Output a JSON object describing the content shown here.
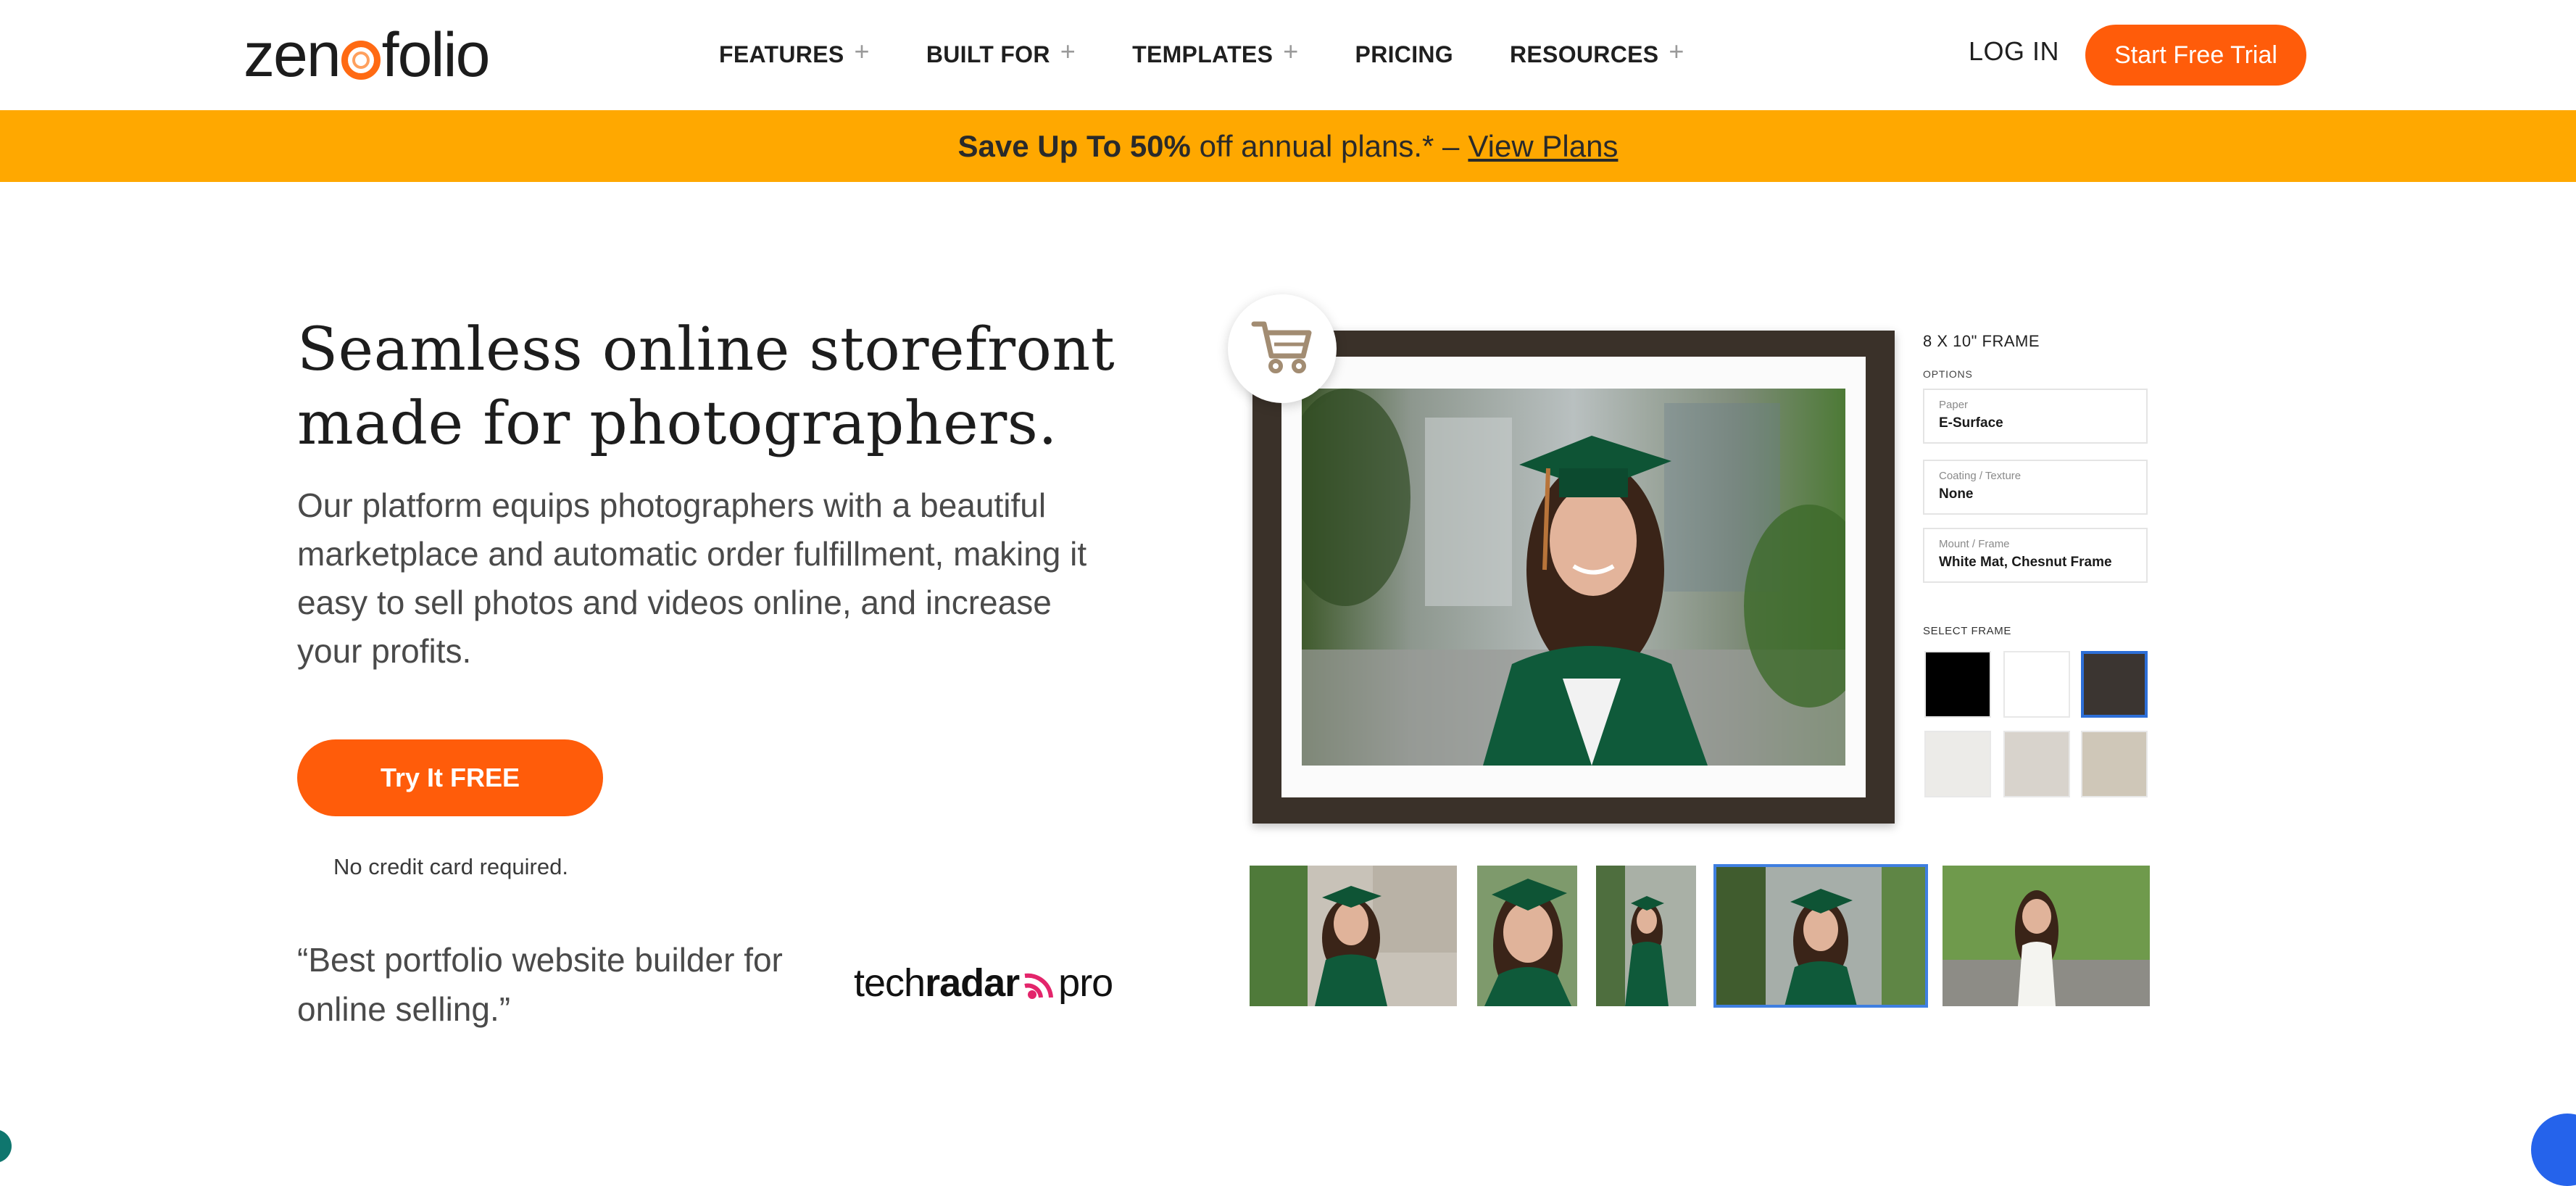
{
  "header": {
    "logo_text_pre": "zen",
    "logo_text_post": "folio",
    "nav": [
      {
        "label": "FEATURES",
        "has_plus": true
      },
      {
        "label": "BUILT FOR",
        "has_plus": true
      },
      {
        "label": "TEMPLATES",
        "has_plus": true
      },
      {
        "label": "PRICING",
        "has_plus": false
      },
      {
        "label": "RESOURCES",
        "has_plus": true
      }
    ],
    "login": "LOG IN",
    "trial_button": "Start Free Trial",
    "plus_icon": "plus-icon"
  },
  "promo": {
    "bold": "Save Up To 50%",
    "rest": "off annual plans.* –",
    "link": "View Plans"
  },
  "hero": {
    "headline_line1": "Seamless online storefront",
    "headline_line2": "made for photographers.",
    "subtext": "Our platform equips photographers with a beautiful marketplace and automatic order fulfillment, making it easy to sell photos and videos online, and increase your profits.",
    "cta": "Try It FREE",
    "no_credit_card": "No credit card required.",
    "quote": "“Best portfolio website builder for online selling.”",
    "techradar_pre": "tech",
    "techradar_bold": "radar",
    "techradar_post": "pro"
  },
  "product": {
    "frame_title": "8 X 10\" FRAME",
    "options_label": "OPTIONS",
    "options": [
      {
        "label": "Paper",
        "value": "E-Surface"
      },
      {
        "label": "Coating / Texture",
        "value": "None"
      },
      {
        "label": "Mount / Frame",
        "value": "White Mat, Chesnut Frame"
      }
    ],
    "select_frame_label": "SELECT FRAME",
    "swatches": [
      "#000000",
      "#ffffff",
      "#3b3531",
      "#ecebe8",
      "#d8d3cc",
      "#cfc7b8"
    ],
    "selected_swatch": 3,
    "selected_thumbnail": 4,
    "thumbnail_count": 5,
    "cart_icon": "shopping-cart-icon"
  },
  "colors": {
    "accent": "#ff5c0a",
    "promo_bg": "#ffa800",
    "selection_blue": "#2d6fd8"
  }
}
